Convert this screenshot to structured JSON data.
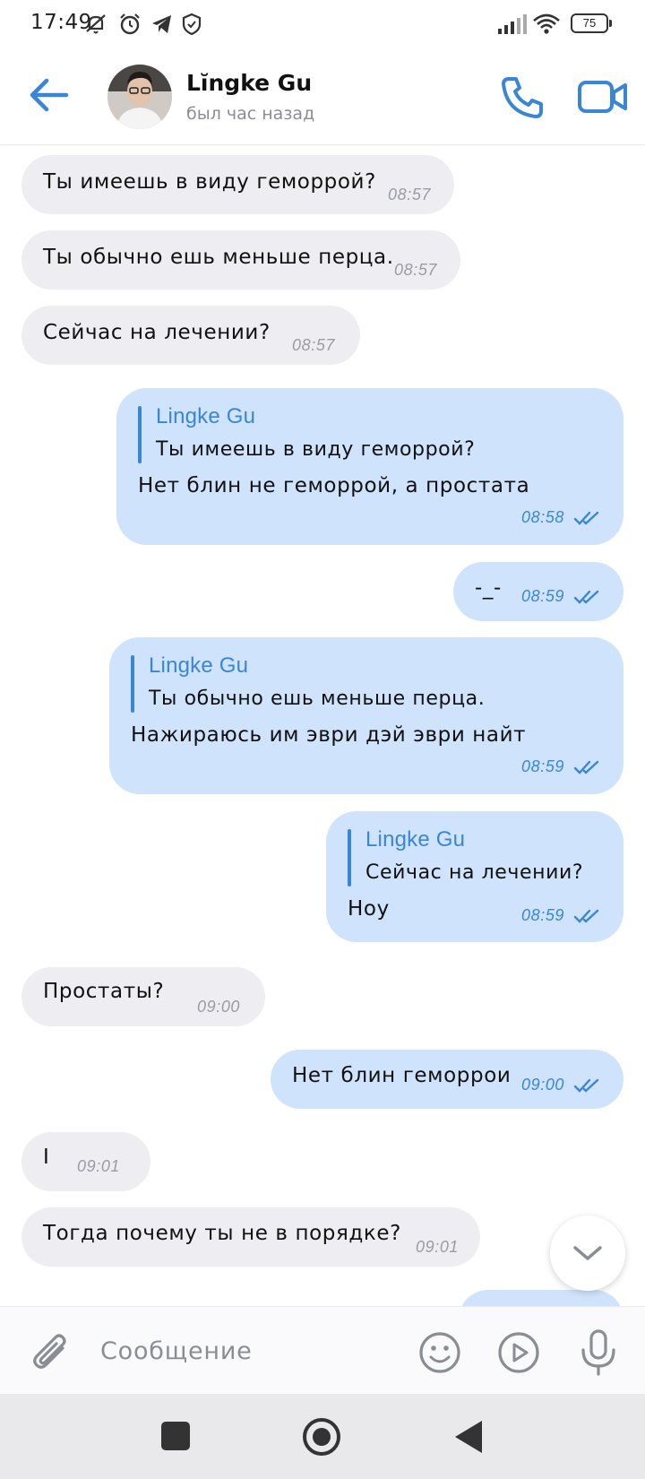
{
  "status_bar": {
    "time": "17:49",
    "battery": "75"
  },
  "header": {
    "contact_name": "Lĭngke Gu",
    "last_seen": "был час назад"
  },
  "messages": [
    {
      "dir": "in",
      "text": "Ты имеешь в виду геморрой?",
      "time": "08:57"
    },
    {
      "dir": "in",
      "text": "Ты обычно ешь меньше перца.",
      "time": "08:57"
    },
    {
      "dir": "in",
      "text": "Сейчас на лечении?",
      "time": "08:57"
    },
    {
      "dir": "out",
      "quote_name": "Lingke Gu",
      "quote_text": "Ты имеешь в виду геморрой?",
      "text": "Нет блин не геморрой, а простата",
      "time": "08:58"
    },
    {
      "dir": "out",
      "text": "-_-",
      "time": "08:59"
    },
    {
      "dir": "out",
      "quote_name": "Lingke Gu",
      "quote_text": "Ты обычно ешь меньше перца.",
      "text": "Нажираюсь им эври дэй эври найт",
      "time": "08:59"
    },
    {
      "dir": "out",
      "quote_name": "Lingke Gu",
      "quote_text": "Сейчас на лечении?",
      "text": "Ноу",
      "time": "08:59"
    },
    {
      "dir": "in",
      "text": "Простаты?",
      "time": "09:00"
    },
    {
      "dir": "out",
      "text": "Нет блин геморрои",
      "time": "09:00"
    },
    {
      "dir": "in",
      "text": "I",
      "time": "09:01"
    },
    {
      "dir": "in",
      "text": "Тогда почему ты не в порядке?",
      "time": "09:01"
    }
  ],
  "composer": {
    "placeholder": "Сообщение"
  },
  "colors": {
    "accent": "#3a86d6",
    "incoming_bubble": "#eeeef2",
    "outgoing_bubble": "#cfe3fc"
  },
  "icons": [
    "back-arrow-icon",
    "phone-icon",
    "video-camera-icon",
    "paperclip-icon",
    "emoji-icon",
    "gif-play-icon",
    "microphone-icon",
    "chevron-down-icon"
  ]
}
